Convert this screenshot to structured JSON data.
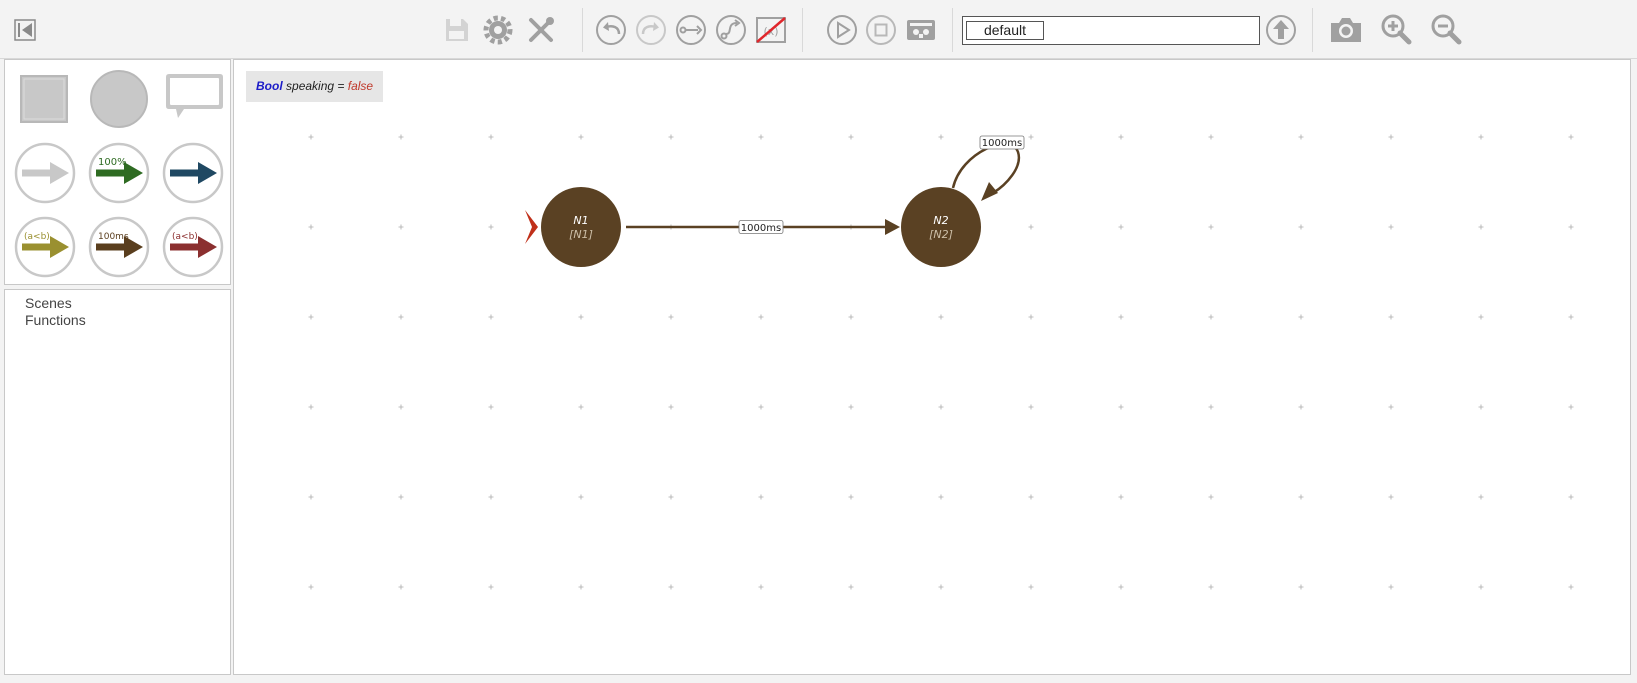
{
  "toolbar": {
    "buttons": [
      {
        "name": "collapse-sidebar-button",
        "icon": "skip-back-icon"
      },
      {
        "name": "save-button",
        "icon": "save-icon"
      },
      {
        "name": "settings-button",
        "icon": "gear-icon"
      },
      {
        "name": "tools-button",
        "icon": "tools-icon"
      },
      {
        "name": "undo-button",
        "icon": "undo-icon"
      },
      {
        "name": "redo-button",
        "icon": "redo-icon"
      },
      {
        "name": "straight-edge-button",
        "icon": "straight-edge-icon"
      },
      {
        "name": "curved-edge-button",
        "icon": "curved-edge-icon"
      },
      {
        "name": "toggle-edge-labels-button",
        "icon": "edge-labels-off-icon"
      },
      {
        "name": "play-button",
        "icon": "play-icon"
      },
      {
        "name": "stop-button",
        "icon": "stop-icon"
      },
      {
        "name": "run-config-button",
        "icon": "robot-icon"
      },
      {
        "name": "scene-up-button",
        "icon": "arrow-up-icon"
      },
      {
        "name": "screenshot-button",
        "icon": "camera-icon"
      },
      {
        "name": "zoom-in-button",
        "icon": "zoom-in-icon"
      },
      {
        "name": "zoom-out-button",
        "icon": "zoom-out-icon"
      }
    ],
    "scene_name": "default"
  },
  "palette": {
    "items": [
      {
        "name": "supernode-tool",
        "icon": "square-icon"
      },
      {
        "name": "node-tool",
        "icon": "circle-icon"
      },
      {
        "name": "comment-tool",
        "icon": "speech-bubble-icon"
      },
      {
        "name": "epsilon-edge-tool",
        "icon": "arrow-icon",
        "color": "#c8c8c8",
        "label": ""
      },
      {
        "name": "probability-edge-tool",
        "icon": "arrow-icon",
        "color": "#2e6b22",
        "label": "100%"
      },
      {
        "name": "interrupt-edge-tool",
        "icon": "arrow-icon",
        "color": "#1f4862",
        "label": ""
      },
      {
        "name": "conditional-edge-tool",
        "icon": "arrow-icon",
        "color": "#9a9030",
        "label": "(a<b)"
      },
      {
        "name": "timeout-edge-tool",
        "icon": "arrow-icon",
        "color": "#5a3e1e",
        "label": "100ms"
      },
      {
        "name": "interrupt-condition-edge-tool",
        "icon": "arrow-icon",
        "color": "#8b2f2f",
        "label": "(a<b)"
      }
    ]
  },
  "tree": {
    "scenes_label": "Scenes",
    "functions_label": "Functions"
  },
  "canvas": {
    "variable": {
      "type": "Bool",
      "text": "speaking =",
      "value": "false"
    },
    "colors": {
      "node": "#5a4123",
      "edge": "#5a4123",
      "start_marker": "#c0301a",
      "grid": "#aaaaaa"
    },
    "nodes": [
      {
        "id": "N1",
        "label": "N1",
        "sub": "[N1]",
        "start": true
      },
      {
        "id": "N2",
        "label": "N2",
        "sub": "[N2]",
        "start": false
      }
    ],
    "edges": [
      {
        "from": "N1",
        "to": "N2",
        "label": "1000ms",
        "type": "timeout"
      },
      {
        "from": "N2",
        "to": "N2",
        "label": "1000ms",
        "type": "timeout-self-loop"
      }
    ]
  }
}
